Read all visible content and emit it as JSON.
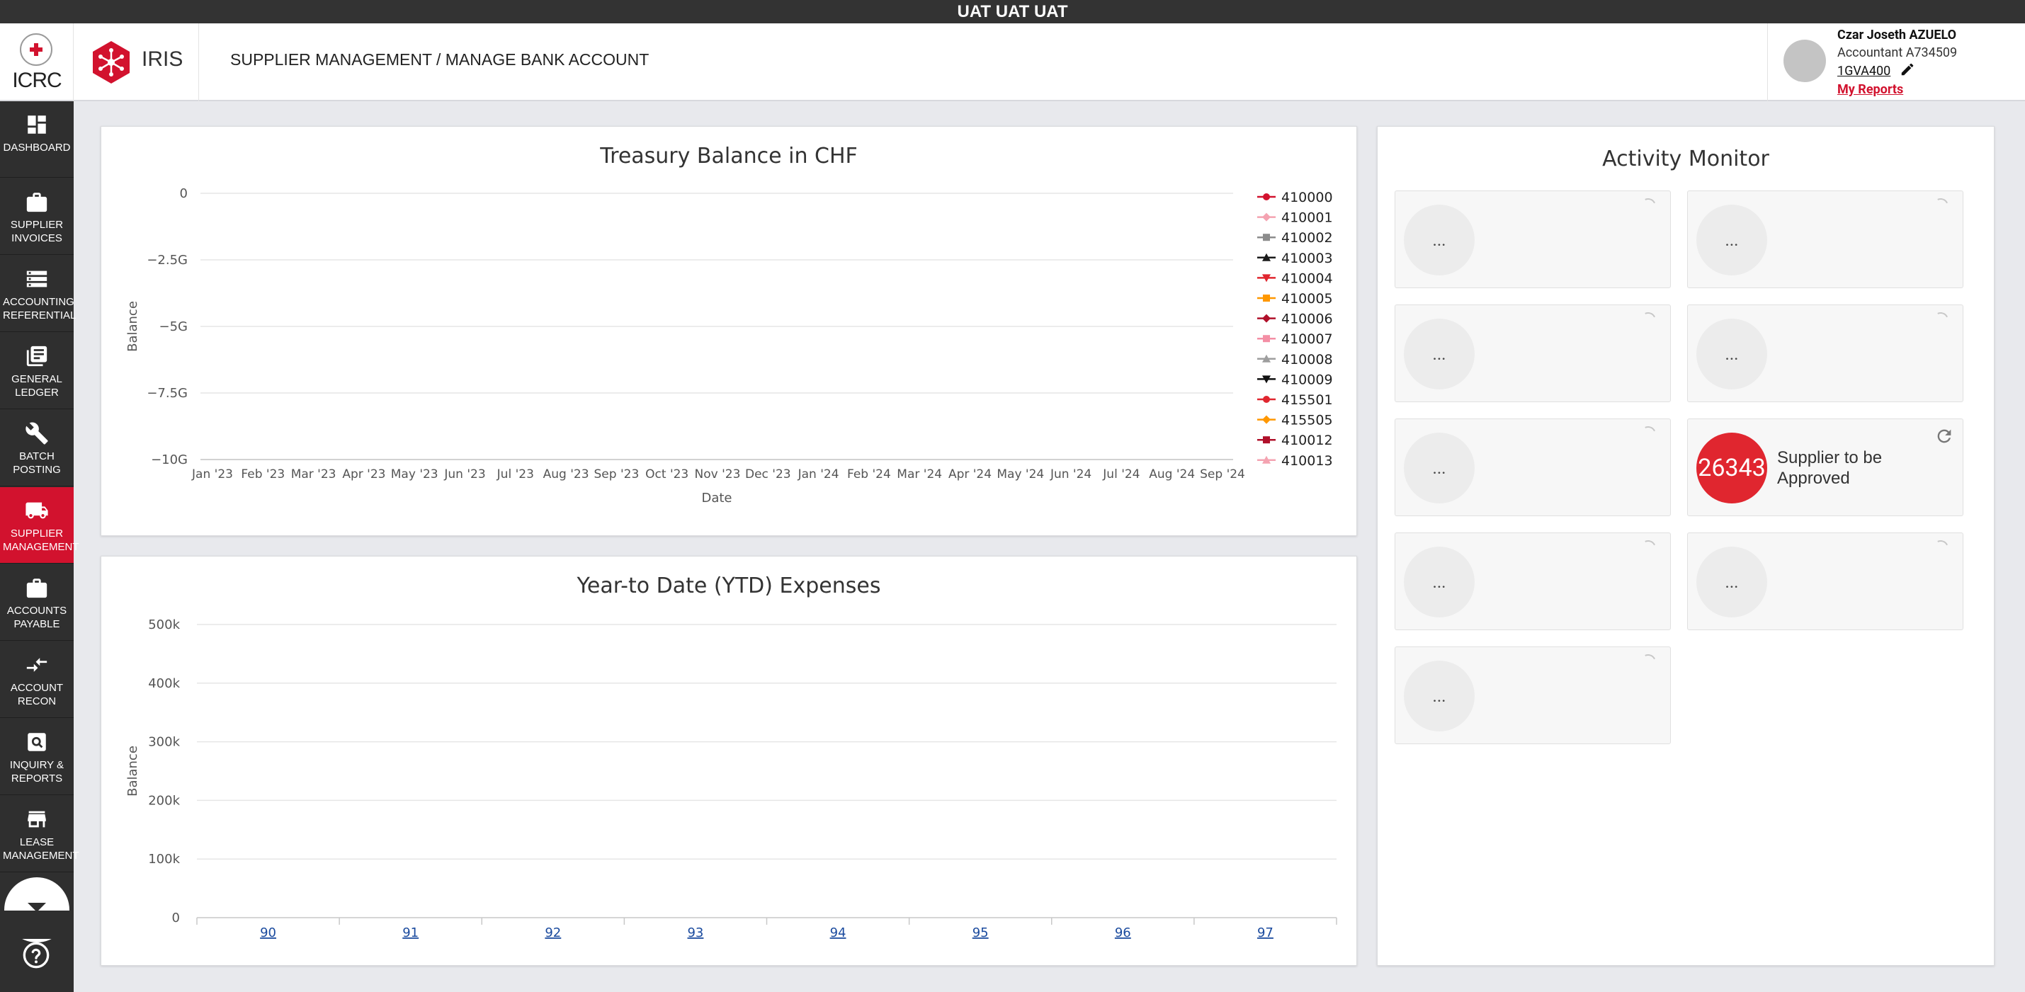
{
  "env_banner": "UAT UAT UAT",
  "header": {
    "icrc_logo": "ICRC",
    "iris_logo": "IRIS",
    "breadcrumb": "SUPPLIER MANAGEMENT / MANAGE BANK ACCOUNT",
    "user": {
      "name": "Czar Joseth AZUELO",
      "role": "Accountant A734509",
      "code": "1GVA400",
      "reports_link": "My Reports"
    }
  },
  "sidebar": {
    "items": [
      {
        "label": "DASHBOARD",
        "icon": "dashboard-icon"
      },
      {
        "label": "SUPPLIER INVOICES",
        "icon": "briefcase-icon"
      },
      {
        "label": "ACCOUNTING REFERENTIAL",
        "icon": "storage-icon"
      },
      {
        "label": "GENERAL LEDGER",
        "icon": "book-icon"
      },
      {
        "label": "BATCH POSTING",
        "icon": "wrench-icon"
      },
      {
        "label": "SUPPLIER MANAGEMENT",
        "icon": "truck-icon"
      },
      {
        "label": "ACCOUNTS PAYABLE",
        "icon": "briefcase-icon"
      },
      {
        "label": "ACCOUNT RECON",
        "icon": "compare-arrows-icon"
      },
      {
        "label": "INQUIRY & REPORTS",
        "icon": "search-box-icon"
      },
      {
        "label": "LEASE MANAGEMENT",
        "icon": "store-icon"
      }
    ],
    "active_index": 5,
    "active_color": "#d2122e"
  },
  "treasury": {
    "title": "Treasury Balance in CHF",
    "chart_data": {
      "type": "line",
      "title": "Treasury Balance in CHF",
      "xlabel": "Date",
      "ylabel": "Balance",
      "x": [
        "Jan '23",
        "Feb '23",
        "Mar '23",
        "Apr '23",
        "May '23",
        "Jun '23",
        "Jul '23",
        "Aug '23",
        "Sep '23",
        "Oct '23",
        "Nov '23",
        "Dec '23",
        "Jan '24",
        "Feb '24",
        "Mar '24",
        "Apr '24",
        "May '24",
        "Jun '24",
        "Jul '24",
        "Aug '24",
        "Sep '24"
      ],
      "yticks": [
        "0",
        "−2.5G",
        "−5G",
        "−7.5G",
        "−10G"
      ],
      "ylim": [
        -10000000000,
        0
      ],
      "grid": true,
      "legend_position": "right",
      "series": [
        {
          "name": "410000",
          "color": "#d2122e",
          "marker": "circle",
          "values": []
        },
        {
          "name": "410001",
          "color": "#f4a3b1",
          "marker": "diamond",
          "values": []
        },
        {
          "name": "410002",
          "color": "#8c8c8c",
          "marker": "square",
          "values": []
        },
        {
          "name": "410003",
          "color": "#1a1a1a",
          "marker": "triangle",
          "values": []
        },
        {
          "name": "410004",
          "color": "#e0262f",
          "marker": "triangle-down",
          "values": []
        },
        {
          "name": "410005",
          "color": "#ff9800",
          "marker": "square",
          "values": []
        },
        {
          "name": "410006",
          "color": "#b0102a",
          "marker": "diamond",
          "values": []
        },
        {
          "name": "410007",
          "color": "#f48fa5",
          "marker": "square",
          "values": []
        },
        {
          "name": "410008",
          "color": "#9e9e9e",
          "marker": "triangle",
          "values": []
        },
        {
          "name": "410009",
          "color": "#111111",
          "marker": "triangle-down",
          "values": []
        },
        {
          "name": "415501",
          "color": "#e0262f",
          "marker": "circle",
          "values": []
        },
        {
          "name": "415505",
          "color": "#ff9800",
          "marker": "diamond",
          "values": []
        },
        {
          "name": "410012",
          "color": "#b0102a",
          "marker": "square",
          "values": []
        },
        {
          "name": "410013",
          "color": "#f4a3b1",
          "marker": "triangle",
          "values": []
        }
      ]
    }
  },
  "ytd": {
    "title": "Year-to Date (YTD) Expenses",
    "chart_data": {
      "type": "bar",
      "title": "Year-to Date (YTD) Expenses",
      "ylabel": "Balance",
      "categories": [
        "90",
        "91",
        "92",
        "93",
        "94",
        "95",
        "96",
        "97"
      ],
      "yticks": [
        "0",
        "100k",
        "200k",
        "300k",
        "400k",
        "500k"
      ],
      "ylim": [
        0,
        500000
      ],
      "grid": true,
      "values": [
        0,
        0,
        0,
        0,
        0,
        0,
        0,
        0
      ]
    }
  },
  "activity": {
    "title": "Activity Monitor",
    "tiles": [
      {
        "value": "...",
        "label": ""
      },
      {
        "value": "...",
        "label": ""
      },
      {
        "value": "...",
        "label": ""
      },
      {
        "value": "...",
        "label": ""
      },
      {
        "value": "...",
        "label": ""
      },
      {
        "value": "26343",
        "label": "Supplier to be Approved"
      },
      {
        "value": "...",
        "label": ""
      },
      {
        "value": "...",
        "label": ""
      },
      {
        "value": "...",
        "label": ""
      }
    ]
  },
  "help_icon": "help-circle-icon"
}
